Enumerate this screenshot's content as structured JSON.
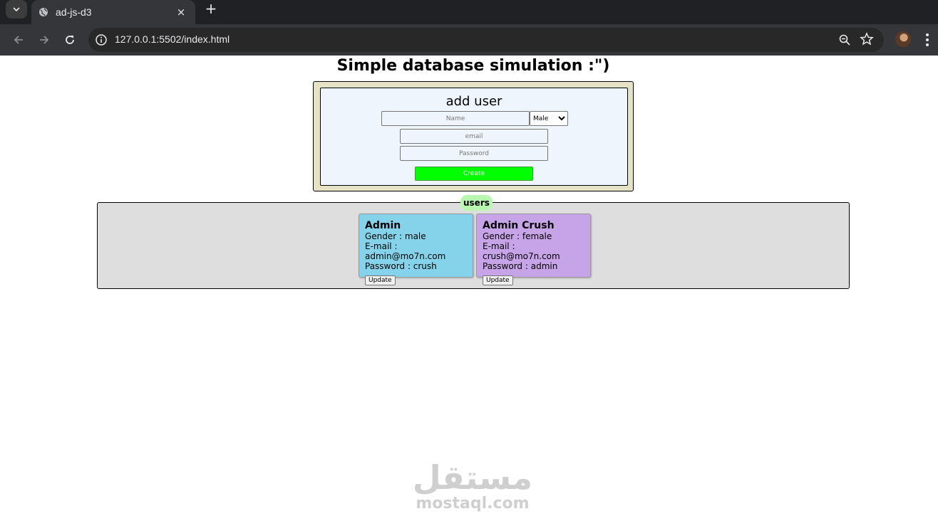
{
  "browser": {
    "tab_title": "ad-js-d3",
    "tab_close": "×",
    "new_tab": "+",
    "url": "127.0.0.1:5502/index.html"
  },
  "page": {
    "title": "Simple database simulation :\")",
    "form": {
      "heading": "add user",
      "name_placeholder": "Name",
      "gender_selected": "Male",
      "gender_options": [
        "Male"
      ],
      "email_placeholder": "email",
      "password_placeholder": "Password",
      "create_label": "Create"
    },
    "users": {
      "legend": "users",
      "update_label": "Update",
      "cards": [
        {
          "name": "Admin",
          "gender": "Gender : male",
          "email": "E-mail : admin@mo7n.com",
          "password": "Password : crush",
          "color": "#85d3ea"
        },
        {
          "name": "Admin Crush",
          "gender": "Gender : female",
          "email": "E-mail : crush@mo7n.com",
          "password": "Password : admin",
          "color": "#c7a3e8"
        }
      ]
    },
    "watermark": {
      "arabic": "مستقل",
      "latin": "mostaql.com"
    }
  },
  "colors": {
    "create_button": "#00ff00",
    "form_outer": "#e6e2c6",
    "form_inner": "#eef5fd",
    "users_box": "#dedede",
    "legend": "#b8f7b0"
  }
}
